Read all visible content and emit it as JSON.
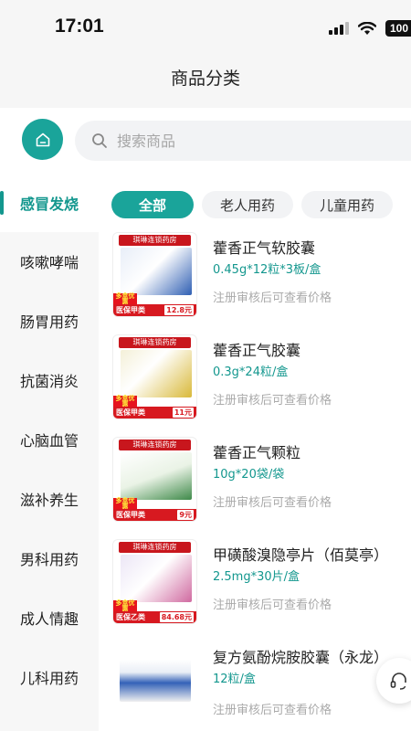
{
  "status": {
    "time": "17:01",
    "battery": "100"
  },
  "header": {
    "title": "商品分类"
  },
  "search": {
    "placeholder": "搜索商品"
  },
  "sidebar": {
    "items": [
      {
        "label": "感冒发烧",
        "active": true
      },
      {
        "label": "咳嗽哮喘"
      },
      {
        "label": "肠胃用药"
      },
      {
        "label": "抗菌消炎"
      },
      {
        "label": "心脑血管"
      },
      {
        "label": "滋补养生"
      },
      {
        "label": "男科用药"
      },
      {
        "label": "成人情趣"
      },
      {
        "label": "儿科用药"
      }
    ]
  },
  "filters": [
    {
      "label": "全部",
      "active": true
    },
    {
      "label": "老人用药"
    },
    {
      "label": "儿童用药"
    }
  ],
  "products": [
    {
      "name": "藿香正气软胶囊",
      "spec": "0.45g*12粒*3板/盒",
      "note": "注册审核后可查看价格",
      "store": "琪琳连锁药房",
      "promo": "多盒优惠",
      "insurance": "医保甲类",
      "price_tag": "12.8元"
    },
    {
      "name": "藿香正气胶囊",
      "spec": "0.3g*24粒/盒",
      "note": "注册审核后可查看价格",
      "store": "琪琳连锁药房",
      "promo": "多盒优惠",
      "insurance": "医保甲类",
      "price_tag": "11元"
    },
    {
      "name": "藿香正气颗粒",
      "spec": "10g*20袋/袋",
      "note": "注册审核后可查看价格",
      "store": "琪琳连锁药房",
      "promo": "多盒优惠",
      "insurance": "医保甲类",
      "price_tag": "9元"
    },
    {
      "name": "甲磺酸溴隐亭片（佰莫亭）",
      "spec": "2.5mg*30片/盒",
      "note": "注册审核后可查看价格",
      "store": "琪琳连锁药房",
      "promo": "多盒优惠",
      "insurance": "医保乙类",
      "price_tag": "84.68元"
    },
    {
      "name": "复方氨酚烷胺胶囊（永龙）",
      "spec": "12粒/盒",
      "note": "注册审核后可查看价格"
    }
  ],
  "colors": {
    "accent": "#1aa49a",
    "accent_text": "#13978e",
    "promo_red": "#d71920"
  }
}
